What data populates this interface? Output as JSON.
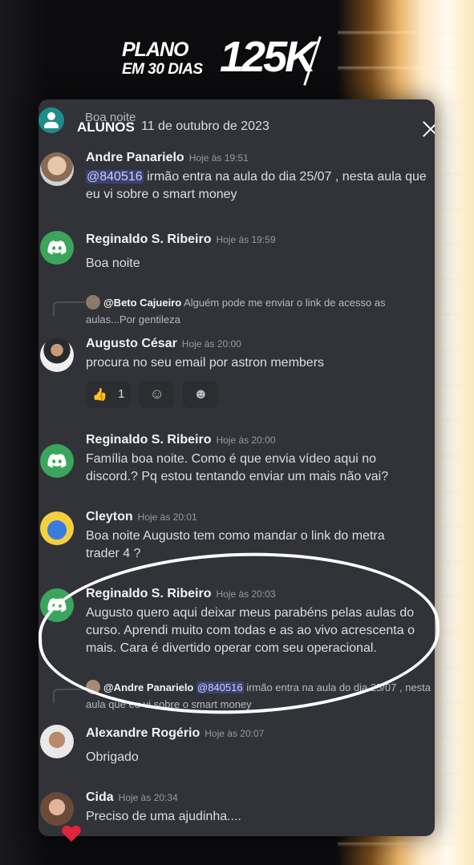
{
  "logo": {
    "plano": "PLANO",
    "dias": "EM 30 DIAS",
    "big": "125K"
  },
  "header": {
    "previous_text": "Boa noite",
    "channel_title": "ALUNOS",
    "date": "11 de outubro de 2023"
  },
  "messages": [
    {
      "author": "Andre Panarielo",
      "time": "Hoje às 19:51",
      "mention": "@840516",
      "text": " irmão entra na aula do dia 25/07 , nesta aula que eu vi sobre o smart money"
    },
    {
      "author": "Reginaldo S. Ribeiro",
      "time": "Hoje às 19:59",
      "text": "Boa noite"
    },
    {
      "reply_author": "@Beto Cajueiro",
      "reply_text": "Alguém pode me enviar o link de acesso as aulas...Por gentileza",
      "author": "Augusto César",
      "time": "Hoje às 20:00",
      "text": "procura no seu email por astron members",
      "reactions": [
        {
          "emoji": "👍",
          "count": "1"
        }
      ]
    },
    {
      "author": "Reginaldo S. Ribeiro",
      "time": "Hoje às 20:00",
      "text": "Família boa noite.  Como é  que envia vídeo aqui no discord.? Pq  estou tentando enviar um mais não vai?"
    },
    {
      "author": "Cleyton",
      "time": "Hoje às 20:01",
      "text": "Boa noite Augusto tem como mandar o link do metra trader 4 ?"
    },
    {
      "author": "Reginaldo S. Ribeiro",
      "time": "Hoje às 20:03",
      "text": "Augusto quero aqui deixar meus parabéns  pelas aulas do curso. Aprendi muito com todas e as ao vivo  acrescenta o mais.   Cara é divertido operar com seu operacional."
    },
    {
      "reply_author": "@Andre Panarielo",
      "reply_mention": "@840516",
      "reply_text": " irmão entra na aula do dia 25/07 , nesta aula que eu vi sobre o smart money",
      "author": "Alexandre Rogério",
      "time": "Hoje às 20:07",
      "text": "Obrigado"
    },
    {
      "author": "Cida",
      "time": "Hoje às 20:34",
      "text": "Preciso de uma ajudinha...."
    }
  ]
}
